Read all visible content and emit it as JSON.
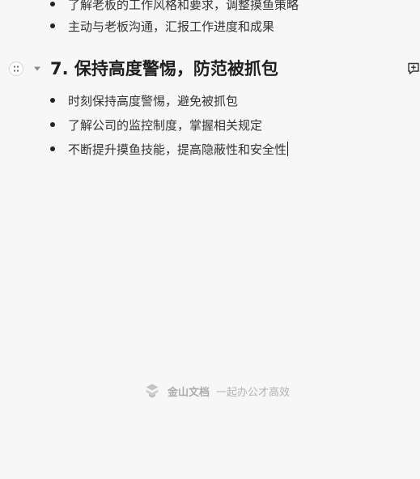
{
  "doc": {
    "top_bullets": [
      "了解老板的工作风格和要求，调整摸鱼策略",
      "主动与老板沟通，汇报工作进度和成果"
    ],
    "heading": "7. 保持高度警惕，防范被抓包",
    "section_bullets": [
      "时刻保持高度警惕，避免被抓包",
      "了解公司的监控制度，掌握相关规定",
      "不断提升摸鱼技能，提高隐蔽性和安全性"
    ]
  },
  "footer": {
    "brand": "金山文档",
    "slogan": "一起办公才高效"
  },
  "icons": {
    "drag": "drag-handle-icon",
    "collapse": "triangle-down-icon",
    "comment": "add-comment-icon",
    "logo": "kingsoft-docs-logo"
  },
  "colors": {
    "background": "#f7f7f7",
    "text": "#222222",
    "footer_text": "#b3b3b3"
  }
}
